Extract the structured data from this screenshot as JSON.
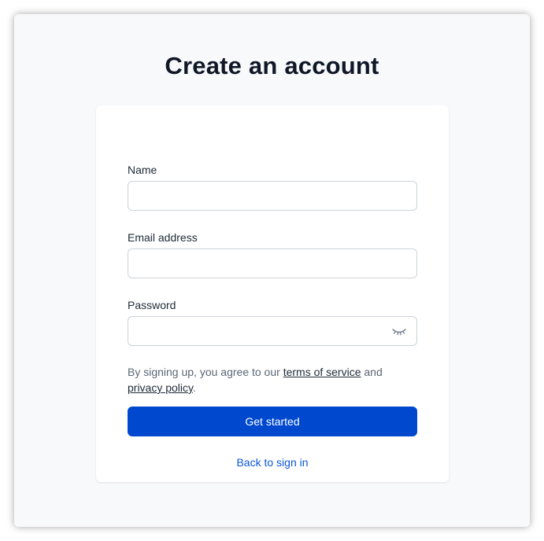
{
  "page": {
    "title": "Create an account"
  },
  "form": {
    "name": {
      "label": "Name",
      "value": "",
      "placeholder": ""
    },
    "email": {
      "label": "Email address",
      "value": "",
      "placeholder": ""
    },
    "password": {
      "label": "Password",
      "value": "",
      "placeholder": "",
      "toggle_icon": "eye-closed-icon"
    },
    "terms": {
      "prefix": "By signing up, you agree to our ",
      "terms_link": "terms of service",
      "middle": " and ",
      "privacy_link": "privacy policy",
      "suffix": "."
    },
    "submit_label": "Get started",
    "back_link": "Back to sign in"
  },
  "colors": {
    "primary": "#0049cf",
    "link": "#0b56d6",
    "title": "#101828",
    "background": "#f8f9fb"
  }
}
